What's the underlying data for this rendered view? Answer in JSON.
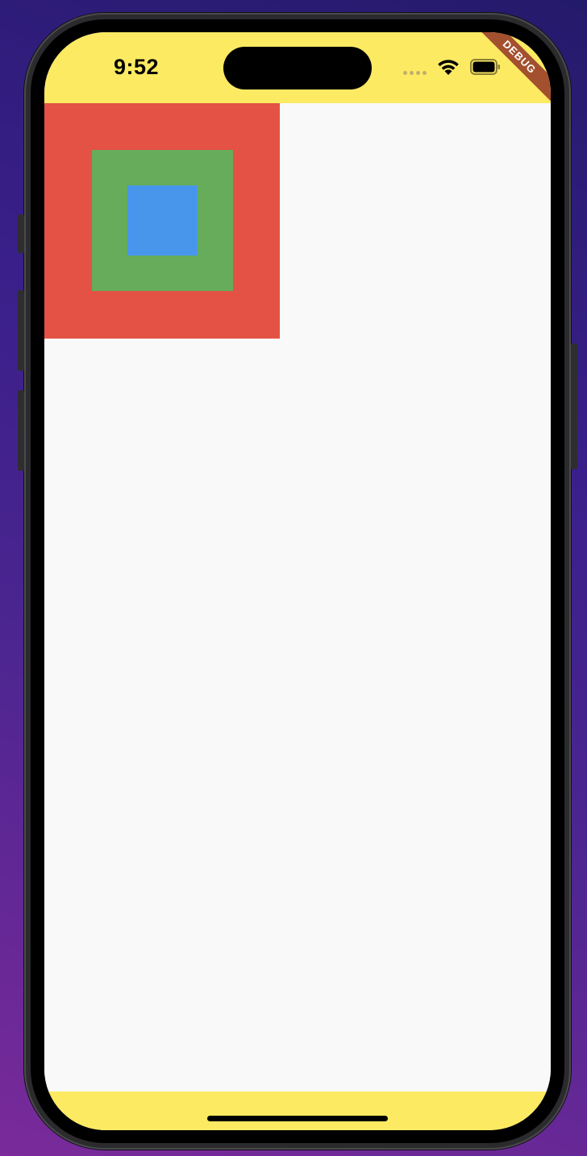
{
  "status_bar": {
    "time": "9:52",
    "wifi_icon": "wifi-icon",
    "battery_icon": "battery-icon",
    "background_color": "#fdea63"
  },
  "debug_banner": {
    "label": "DEBUG",
    "color": "#a3502f"
  },
  "boxes": {
    "outer_color": "#e35244",
    "middle_color": "#67ac5b",
    "inner_color": "#4796ec"
  },
  "bottom_bar": {
    "background_color": "#fdea63"
  }
}
